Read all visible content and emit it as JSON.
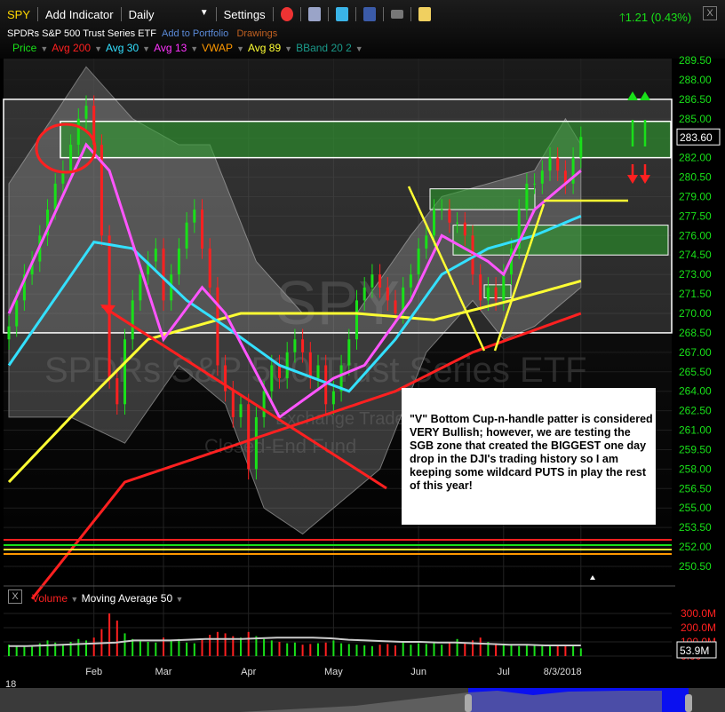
{
  "toolbar": {
    "symbol": "SPY",
    "add_indicator": "Add Indicator",
    "interval": "Daily",
    "settings": "Settings",
    "change": "1.21 (0.43%)",
    "close": "X",
    "icons": [
      "alarm-clock-icon",
      "database-icon",
      "twitter-icon",
      "facebook-icon",
      "camera-icon",
      "note-icon"
    ]
  },
  "info": {
    "name": "SPDRs S&P 500 Trust Series ETF",
    "add_portfolio": "Add to Portfolio",
    "drawings": "Drawings"
  },
  "legend": [
    {
      "label": "Price",
      "color": "#19e019"
    },
    {
      "label": "Avg 200",
      "color": "#ff2020"
    },
    {
      "label": "Avg 30",
      "color": "#33e0ff"
    },
    {
      "label": "Avg 13",
      "color": "#ff33ff"
    },
    {
      "label": "VWAP",
      "color": "#ff9900"
    },
    {
      "label": "Avg 89",
      "color": "#ffff33"
    },
    {
      "label": "BBand 20 2",
      "color": "#1a9a8a"
    }
  ],
  "watermark": {
    "symbol": "SPY",
    "name": "SPDRs S&P 500 Trust Series ETF",
    "sub1": "Exchange Traded",
    "sub2": "Closed-End Fund"
  },
  "annotation": "\"V\" Bottom Cup-n-handle patter is considered VERY Bullish; however, we are testing the SGB zone that created the BIGGEST one day drop in the DJI's trading history so I am keeping some wildcard PUTS in play the rest of this year!",
  "volume_panel": {
    "close": "X",
    "title": "Volume",
    "ma": "Moving Average 50",
    "ticks": [
      "300.0M",
      "200.0M",
      "100.0M",
      "0.00"
    ],
    "last": "53.9M"
  },
  "chart_data": {
    "type": "candlestick",
    "ylim": [
      250.5,
      289.5
    ],
    "yticks": [
      "289.50",
      "288.00",
      "286.50",
      "285.00",
      "283.50",
      "282.00",
      "280.50",
      "279.00",
      "277.50",
      "276.00",
      "274.50",
      "273.00",
      "271.50",
      "270.00",
      "268.50",
      "267.00",
      "265.50",
      "264.00",
      "262.50",
      "261.00",
      "259.50",
      "258.00",
      "256.50",
      "255.00",
      "253.50",
      "252.00",
      "250.50"
    ],
    "xticks": [
      {
        "label": "Feb",
        "i": 11
      },
      {
        "label": "Mar",
        "i": 20
      },
      {
        "label": "Apr",
        "i": 31
      },
      {
        "label": "May",
        "i": 42
      },
      {
        "label": "Jun",
        "i": 53
      },
      {
        "label": "Jul",
        "i": 64
      },
      {
        "label": "8/3/2018",
        "i": 74
      }
    ],
    "year_label": "18",
    "last_price": "283.60",
    "closes": [
      269,
      271,
      273,
      274,
      276,
      278,
      280,
      281,
      283,
      285,
      286,
      283,
      276,
      265,
      263,
      268,
      271,
      273,
      274,
      275,
      271,
      273,
      275,
      277,
      278,
      275,
      272,
      266,
      264,
      262,
      263,
      258,
      262,
      264,
      266,
      265,
      267,
      268,
      267,
      265,
      266,
      263,
      264,
      266,
      268,
      271,
      272,
      273,
      272,
      271,
      270,
      272,
      273,
      275,
      276,
      278,
      278,
      277,
      277,
      276,
      273,
      271,
      272,
      271,
      273,
      275,
      278,
      280,
      280,
      281,
      282,
      281,
      280,
      282,
      283.6
    ],
    "volumes_m": [
      80,
      70,
      65,
      75,
      90,
      110,
      95,
      85,
      100,
      120,
      110,
      130,
      190,
      300,
      250,
      160,
      120,
      110,
      100,
      95,
      130,
      110,
      120,
      95,
      90,
      120,
      150,
      170,
      160,
      140,
      130,
      170,
      140,
      120,
      110,
      100,
      90,
      95,
      80,
      85,
      90,
      95,
      110,
      90,
      85,
      80,
      75,
      70,
      80,
      85,
      75,
      95,
      80,
      90,
      85,
      95,
      80,
      100,
      120,
      95,
      110,
      130,
      100,
      90,
      80,
      85,
      70,
      75,
      80,
      75,
      70,
      80,
      75,
      70,
      53.9
    ],
    "volume_ma50_m": [
      70,
      70,
      75,
      80,
      85,
      90,
      95,
      110,
      110,
      110,
      115,
      120,
      120,
      120,
      125,
      130,
      130,
      130,
      125,
      115,
      110,
      105,
      100,
      100,
      95,
      95,
      90,
      85,
      80,
      80,
      75,
      75,
      75
    ],
    "series": [
      {
        "name": "Avg 200",
        "color": "#ff2020",
        "points": [
          [
            3,
            248
          ],
          [
            15,
            257
          ],
          [
            35,
            261
          ],
          [
            50,
            264
          ],
          [
            60,
            267
          ],
          [
            74,
            270
          ]
        ]
      },
      {
        "name": "Avg 89",
        "color": "#ffff33",
        "points": [
          [
            0,
            257
          ],
          [
            8,
            262
          ],
          [
            18,
            268
          ],
          [
            30,
            270
          ],
          [
            45,
            270
          ],
          [
            55,
            269.5
          ],
          [
            65,
            271
          ],
          [
            74,
            272.5
          ]
        ]
      },
      {
        "name": "Avg 30",
        "color": "#33e0ff",
        "points": [
          [
            0,
            266
          ],
          [
            11,
            275.5
          ],
          [
            16,
            275
          ],
          [
            23,
            271
          ],
          [
            28,
            269
          ],
          [
            35,
            266
          ],
          [
            44,
            264
          ],
          [
            50,
            268
          ],
          [
            56,
            273
          ],
          [
            62,
            275
          ],
          [
            68,
            276
          ],
          [
            74,
            277.5
          ]
        ]
      },
      {
        "name": "Avg 13",
        "color": "#ff55ff",
        "points": [
          [
            0,
            270
          ],
          [
            10,
            283
          ],
          [
            13,
            281
          ],
          [
            20,
            268
          ],
          [
            25,
            272
          ],
          [
            28,
            270
          ],
          [
            35,
            262
          ],
          [
            42,
            265
          ],
          [
            46,
            266
          ],
          [
            52,
            271
          ],
          [
            56,
            276
          ],
          [
            62,
            274
          ],
          [
            64,
            273
          ],
          [
            68,
            278
          ],
          [
            74,
            281
          ]
        ]
      }
    ],
    "bband_upper": [
      [
        0,
        280
      ],
      [
        10,
        289
      ],
      [
        16,
        285
      ],
      [
        22,
        283
      ],
      [
        26,
        283
      ],
      [
        32,
        274
      ],
      [
        38,
        270
      ],
      [
        45,
        270
      ],
      [
        52,
        276
      ],
      [
        56,
        279
      ],
      [
        62,
        280
      ],
      [
        68,
        281
      ],
      [
        72,
        285
      ],
      [
        74,
        283
      ]
    ],
    "bband_lower": [
      [
        0,
        262
      ],
      [
        8,
        262
      ],
      [
        15,
        260
      ],
      [
        22,
        266
      ],
      [
        28,
        263
      ],
      [
        33,
        255
      ],
      [
        38,
        253
      ],
      [
        48,
        258
      ],
      [
        54,
        267
      ],
      [
        60,
        271
      ],
      [
        64,
        268
      ],
      [
        68,
        269
      ],
      [
        74,
        272
      ]
    ]
  }
}
